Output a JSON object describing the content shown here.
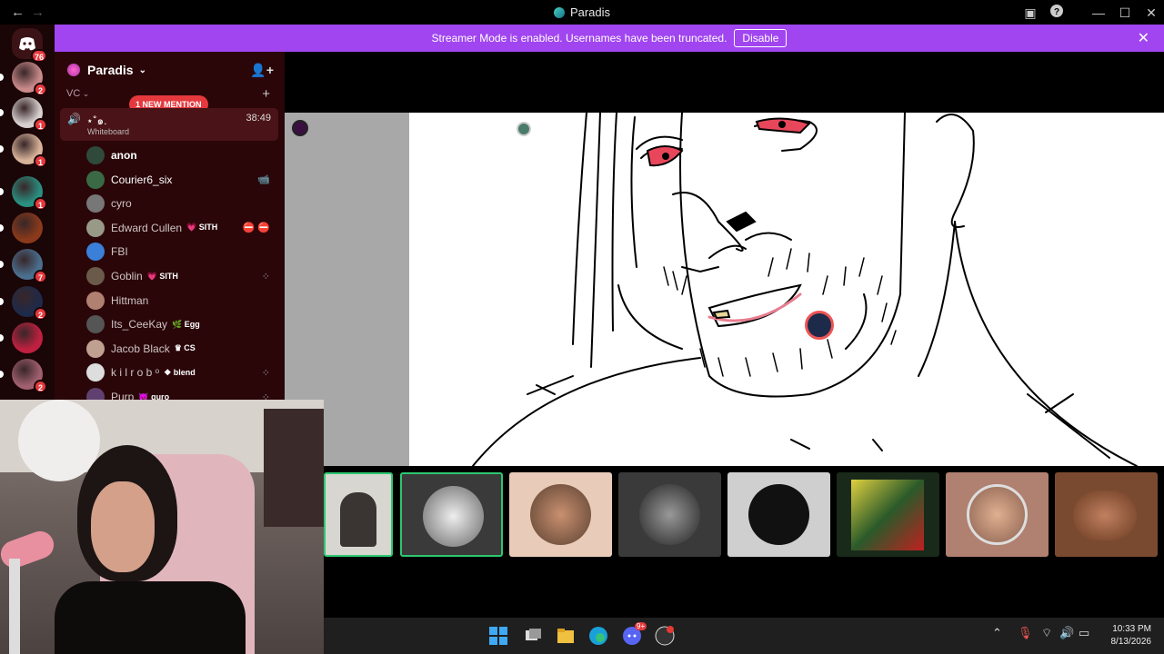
{
  "window": {
    "title": "Paradis",
    "back": "←",
    "forward": "→"
  },
  "banner": {
    "text": "Streamer Mode is enabled. Usernames have been truncated.",
    "button": "Disable"
  },
  "rail": {
    "home_badge": "76",
    "servers": [
      {
        "badge": "2",
        "color": "#c98a8a"
      },
      {
        "badge": "1",
        "color": "#d8d0d0"
      },
      {
        "badge": "1",
        "color": "#d9b49a"
      },
      {
        "badge": "1",
        "color": "#2a8f80"
      },
      {
        "badge": "",
        "color": "#8a3a1a"
      },
      {
        "badge": "7",
        "color": "#4a6f8f"
      },
      {
        "badge": "2",
        "color": "#1e2a4a"
      },
      {
        "badge": "",
        "color": "#c02040"
      },
      {
        "badge": "2",
        "color": "#a06070"
      }
    ]
  },
  "sidebar": {
    "server_name": "Paradis",
    "category": "VC",
    "mention": "1 NEW MENTION",
    "voice_channel": {
      "name": "⋆˚๑.",
      "time": "38:49",
      "activity": "Whiteboard"
    },
    "members": [
      {
        "name": "anon",
        "tag": "",
        "color": "#2f4a3a"
      },
      {
        "name": "Courier6_six",
        "tag": "",
        "color": "#3a6a45",
        "right": "📹"
      },
      {
        "name": "cyro",
        "tag": "",
        "color": "#777"
      },
      {
        "name": "Edward Cullen",
        "tag": "💗 SITH",
        "color": "#998",
        "right": "⛔ ⛔"
      },
      {
        "name": "FBI",
        "tag": "",
        "color": "#3a7fd8"
      },
      {
        "name": "Goblin",
        "tag": "💗 SITH",
        "color": "#6a5a4a",
        "right": "⁘"
      },
      {
        "name": "Hittman",
        "tag": "",
        "color": "#b08070"
      },
      {
        "name": "Its_CeeKay",
        "tag": "🌿 Egg",
        "color": "#555"
      },
      {
        "name": "Jacob Black",
        "tag": "♛ CS",
        "color": "#c0a090"
      },
      {
        "name": "k i l r o b ᵒ",
        "tag": "❖ blend",
        "color": "#ddd",
        "right": "⁘"
      },
      {
        "name": "Purp",
        "tag": "😈 guro",
        "color": "#604070",
        "right": "⁘"
      }
    ]
  },
  "colors": {
    "accent": "#a045f0",
    "mention": "#e5393e",
    "speaking": "#2dc770"
  },
  "taskbar": {
    "time": "10:33 PM",
    "date": "8/13/2026",
    "discord_badge": "9+"
  }
}
